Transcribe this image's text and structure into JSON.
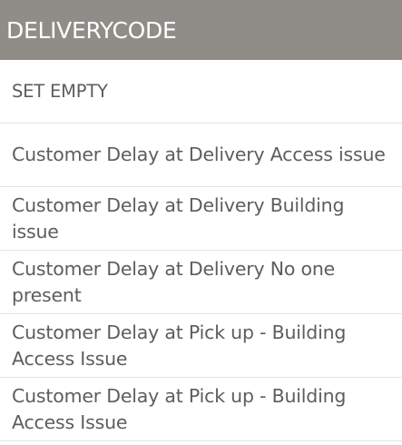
{
  "header": {
    "title": "DELIVERYCODE"
  },
  "list": {
    "items": [
      {
        "label": "SET EMPTY"
      },
      {
        "label": "Customer Delay at Delivery  Access issue"
      },
      {
        "label": "Customer Delay at Delivery  Building issue"
      },
      {
        "label": "Customer Delay at Delivery  No one present"
      },
      {
        "label": "Customer Delay at Pick up - Building Access Issue"
      },
      {
        "label": "Customer Delay at Pick up - Building Access Issue"
      }
    ]
  },
  "colors": {
    "header_bg": "#8f8d88",
    "header_text": "#ffffff",
    "item_text": "#5d5d5d",
    "divider": "#e4e4e4"
  }
}
